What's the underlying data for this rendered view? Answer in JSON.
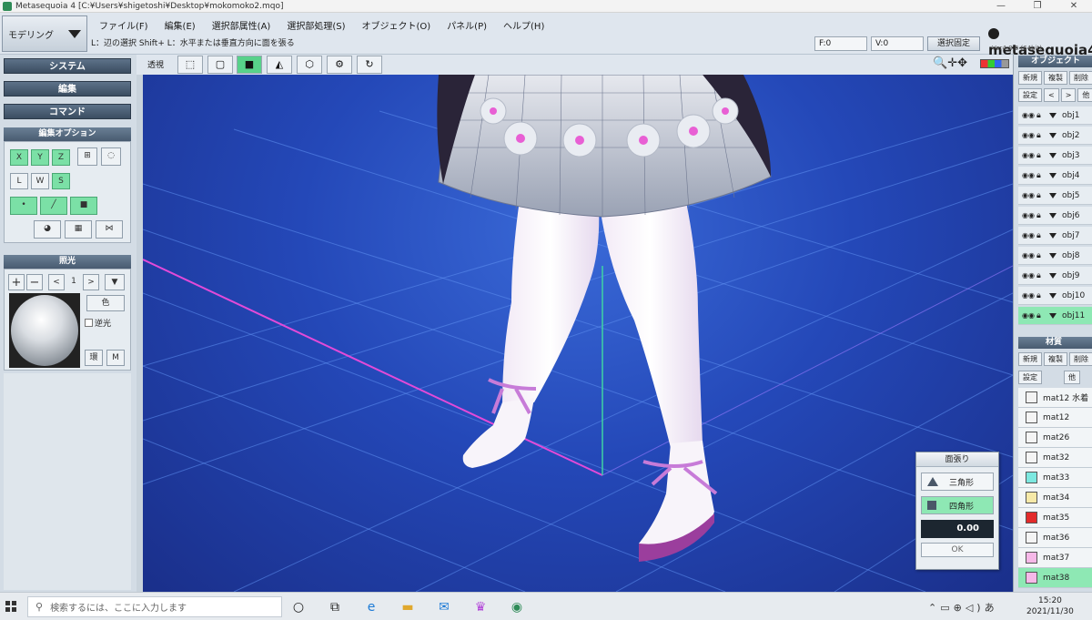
{
  "window": {
    "title": "Metasequoia 4 [C:¥Users¥shigetoshi¥Desktop¥mokomoko2.mqo]"
  },
  "mode": {
    "label": "モデリング"
  },
  "menu": [
    "ファイル(F)",
    "編集(E)",
    "選択部属性(A)",
    "選択部処理(S)",
    "オブジェクト(O)",
    "パネル(P)",
    "ヘルプ(H)"
  ],
  "hint": "L：辺の選択  Shift+ L：水平または垂直方向に面を張る",
  "counts": {
    "faces": "F:0",
    "vertices": "V:0"
  },
  "lock_button": "選択固定",
  "logo": {
    "name": "metasequoia4",
    "version": "Ver4.8.6 (64bit)"
  },
  "left": {
    "system": "システム",
    "edit": "編集",
    "command": "コマンド",
    "edit_options": {
      "title": "編集オプション",
      "axes": [
        "X",
        "Y",
        "Z"
      ],
      "lws": [
        "L",
        "W",
        "S"
      ]
    },
    "lighting": {
      "title": "照光",
      "num": "1",
      "color": "色",
      "reverse": "逆光",
      "env": "環",
      "m": "M"
    }
  },
  "viewport": {
    "perspective_label": "透視"
  },
  "face_panel": {
    "title": "面張り",
    "triangle": "三角形",
    "quad": "四角形",
    "value": "0.00",
    "ok": "OK"
  },
  "objects": {
    "title": "オブジェクト",
    "buttons": [
      "新規",
      "複製",
      "削除"
    ],
    "buttons2": [
      "設定",
      "<",
      ">",
      "他"
    ],
    "rows": [
      "obj1",
      "obj2",
      "obj3",
      "obj4",
      "obj5",
      "obj6",
      "obj7",
      "obj8",
      "obj9",
      "obj10",
      "obj11"
    ]
  },
  "materials": {
    "title": "材質",
    "buttons": [
      "新規",
      "複製",
      "削除"
    ],
    "buttons2": [
      "設定",
      "他"
    ],
    "rows": [
      {
        "name": "mat12 水着",
        "color": "#f2f2f2"
      },
      {
        "name": "mat12",
        "color": "#f4f4f4"
      },
      {
        "name": "mat26",
        "color": "#f4f4f4"
      },
      {
        "name": "mat32",
        "color": "#f4f4f4"
      },
      {
        "name": "mat33",
        "color": "#7de8e0"
      },
      {
        "name": "mat34",
        "color": "#f6e9a8"
      },
      {
        "name": "mat35",
        "color": "#e32b2b"
      },
      {
        "name": "mat36",
        "color": "#f4f4f4"
      },
      {
        "name": "mat37",
        "color": "#f6b8e8"
      },
      {
        "name": "mat38",
        "color": "#f6b8e8"
      }
    ]
  },
  "taskbar": {
    "search_placeholder": "検索するには、ここに入力します",
    "time": "15:20",
    "date": "2021/11/30"
  }
}
